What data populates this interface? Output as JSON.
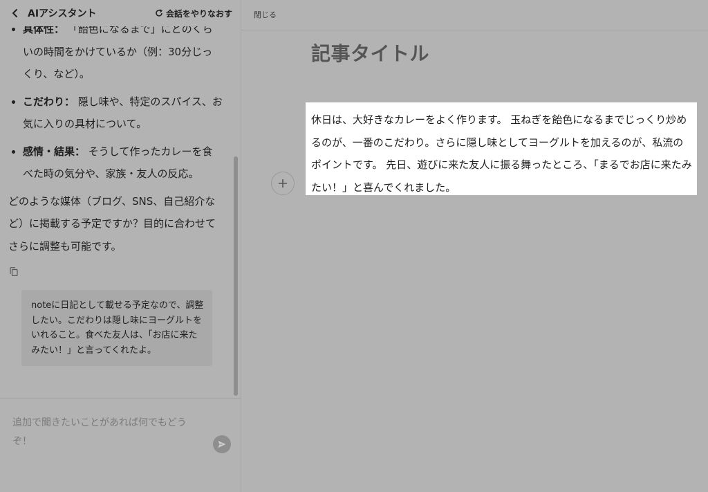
{
  "header": {
    "title": "AIアシスタント",
    "restart_label": "会話をやりなおす"
  },
  "chat": {
    "bullets": [
      {
        "label": "具体性：",
        "text": "「飴色になるまで」にどのくらいの時間をかけているか（例：30分じっくり、など）。"
      },
      {
        "label": "こだわり：",
        "text": "隠し味や、特定のスパイス、お気に入りの具材について。"
      },
      {
        "label": "感情・結果：",
        "text": "そうして作ったカレーを食べた時の気分や、家族・友人の反応。"
      }
    ],
    "closing": "どのような媒体（ブログ、SNS、自己紹介など）に掲載する予定ですか？目的に合わせてさらに調整も可能です。",
    "user_message": "noteに日記として載せる予定なので、調整したい。こだわりは隠し味にヨーグルトをいれること。食べた友人は、「お店に来たみたい！」と言ってくれたよ。"
  },
  "composer": {
    "placeholder": "追加で聞きたいことがあれば何でもどうぞ！"
  },
  "editor": {
    "close_label": "閉じる",
    "title": "記事タイトル",
    "body": "休日は、大好きなカレーをよく作ります。 玉ねぎを飴色になるまでじっくり炒めるのが、一番のこだわり。さらに隠し味としてヨーグルトを加えるのが、私流のポイントです。 先日、遊びに来た友人に振る舞ったところ、「まるでお店に来たみたい！」と喜んでくれました。"
  },
  "icons": {
    "back": "chevron-left-icon",
    "restart": "refresh-icon",
    "copy": "copy-icon",
    "send": "send-icon",
    "add": "plus-icon"
  }
}
